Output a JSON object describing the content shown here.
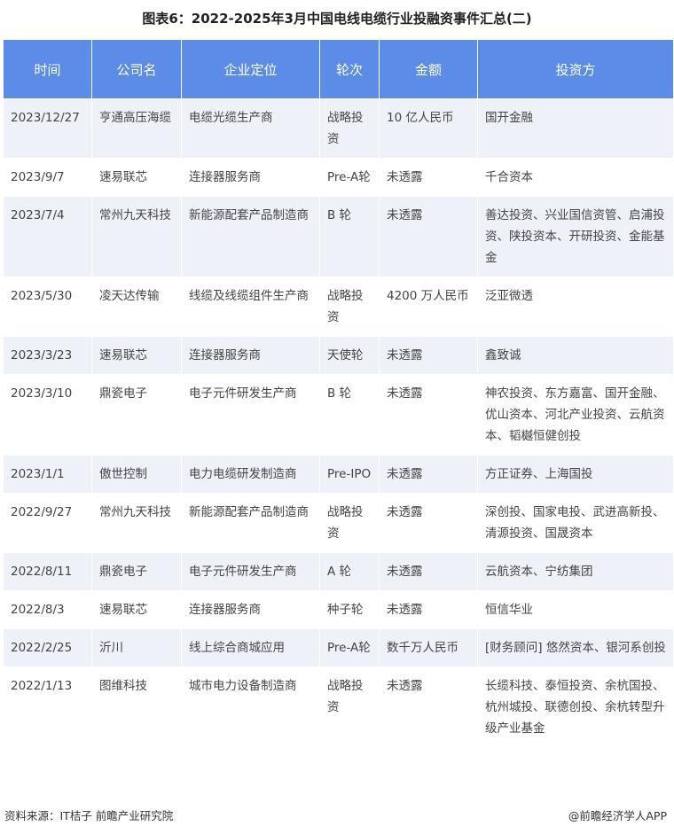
{
  "title": "图表6：2022-2025年3月中国电线电缆行业投融资事件汇总(二)",
  "columns": [
    "时间",
    "公司名",
    "企业定位",
    "轮次",
    "金额",
    "投资方"
  ],
  "rows": [
    [
      "2023/12/27",
      "亨通高压海缆",
      "电缆光缆生产商",
      "战略投资",
      "10 亿人民币",
      "国开金融"
    ],
    [
      "2023/9/7",
      "速易联芯",
      "连接器服务商",
      "Pre-A轮",
      "未透露",
      "千合资本"
    ],
    [
      "2023/7/4",
      "常州九天科技",
      "新能源配套产品制造商",
      "B 轮",
      "未透露",
      "善达投资、兴业国信资管、启浦投资、陕投资本、开研投资、金能基金"
    ],
    [
      "2023/5/30",
      "凌天达传输",
      "线缆及线缆组件生产商",
      "战略投资",
      "4200 万人民币",
      "泛亚微透"
    ],
    [
      "2023/3/23",
      "速易联芯",
      "连接器服务商",
      "天使轮",
      "未透露",
      "鑫致诚"
    ],
    [
      "2023/3/10",
      "鼎瓷电子",
      "电子元件研发生产商",
      "B 轮",
      "未透露",
      "神农投资、东方嘉富、国开金融、优山资本、河北产业投资、云航资本、韬樾恒健创投"
    ],
    [
      "2023/1/1",
      "傲世控制",
      "电力电缆研发制造商",
      "Pre-IPO",
      "未透露",
      "方正证券、上海国投"
    ],
    [
      "2022/9/27",
      "常州九天科技",
      "新能源配套产品制造商",
      "战略投资",
      "未透露",
      "深创投、国家电投、武进高新投、清源投资、国晟资本"
    ],
    [
      "2022/8/11",
      "鼎瓷电子",
      "电子元件研发生产商",
      "A 轮",
      "未透露",
      "云航资本、宁纺集团"
    ],
    [
      "2022/8/3",
      "速易联芯",
      "连接器服务商",
      "种子轮",
      "未透露",
      "恒信华业"
    ],
    [
      "2022/2/25",
      "沂川",
      "线上综合商城应用",
      "Pre-A轮",
      "数千万人民币",
      "[财务顾问] 悠然资本、银河系创投"
    ],
    [
      "2022/1/13",
      "图维科技",
      "城市电力设备制造商",
      "战略投资",
      "未透露",
      "长缆科技、泰恒投资、余杭国投、杭州城投、联德创投、余杭转型升级产业基金"
    ]
  ],
  "footer": {
    "source": "资料来源：IT桔子 前瞻产业研究院",
    "brand": "@前瞻经济学人APP"
  },
  "colors": {
    "header_bg": "#5b8ce8",
    "odd_row_bg": "#eef1f8",
    "even_row_bg": "#ffffff"
  }
}
